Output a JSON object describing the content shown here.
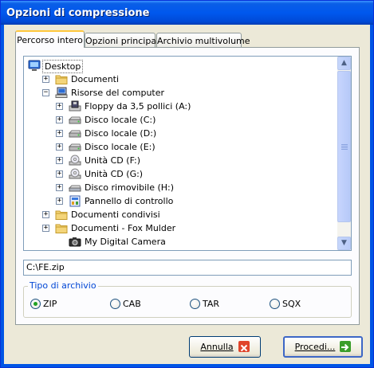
{
  "window": {
    "title": "Opzioni di compressione"
  },
  "tabs": [
    {
      "label": "Percorso intero",
      "active": true
    },
    {
      "label": "Opzioni principali",
      "active": false
    },
    {
      "label": "Archivio multivolume",
      "active": false
    }
  ],
  "tree": {
    "items": [
      {
        "label": "Desktop",
        "icon": "desktop-icon",
        "expander": "",
        "selected": true
      },
      {
        "label": "Documenti",
        "icon": "folder-icon",
        "expander": "+"
      },
      {
        "label": "Risorse del computer",
        "icon": "computer-icon",
        "expander": "-"
      },
      {
        "label": "Floppy da 3,5 pollici (A:)",
        "icon": "floppy-drive-icon",
        "expander": "+"
      },
      {
        "label": "Disco locale (C:)",
        "icon": "hard-drive-icon",
        "expander": "+"
      },
      {
        "label": "Disco locale (D:)",
        "icon": "hard-drive-icon",
        "expander": "+"
      },
      {
        "label": "Disco locale (E:)",
        "icon": "hard-drive-icon",
        "expander": "+"
      },
      {
        "label": "Unità CD (F:)",
        "icon": "cd-drive-icon",
        "expander": "+"
      },
      {
        "label": "Unità CD (G:)",
        "icon": "cd-drive-icon",
        "expander": "+"
      },
      {
        "label": "Disco rimovibile (H:)",
        "icon": "removable-disk-icon",
        "expander": "+"
      },
      {
        "label": "Pannello di controllo",
        "icon": "control-panel-icon",
        "expander": "+"
      },
      {
        "label": "Documenti condivisi",
        "icon": "folder-icon",
        "expander": "+"
      },
      {
        "label": "Documenti - Fox Mulder",
        "icon": "folder-icon",
        "expander": "+"
      },
      {
        "label": "My Digital Camera",
        "icon": "camera-icon",
        "expander": ""
      }
    ]
  },
  "path": {
    "value": "C:\\FE.zip"
  },
  "archive_type": {
    "legend": "Tipo di archivio",
    "options": [
      {
        "label": "ZIP",
        "checked": true
      },
      {
        "label": "CAB",
        "checked": false
      },
      {
        "label": "TAR",
        "checked": false
      },
      {
        "label": "SQX",
        "checked": false
      }
    ]
  },
  "buttons": {
    "cancel_label": "Annulla",
    "proceed_label": "Procedi..."
  },
  "colors": {
    "titlebar": "#0058ee",
    "group_legend": "#0046d5",
    "cancel_icon": "#e0452b",
    "proceed_icon": "#3a9e2a"
  }
}
